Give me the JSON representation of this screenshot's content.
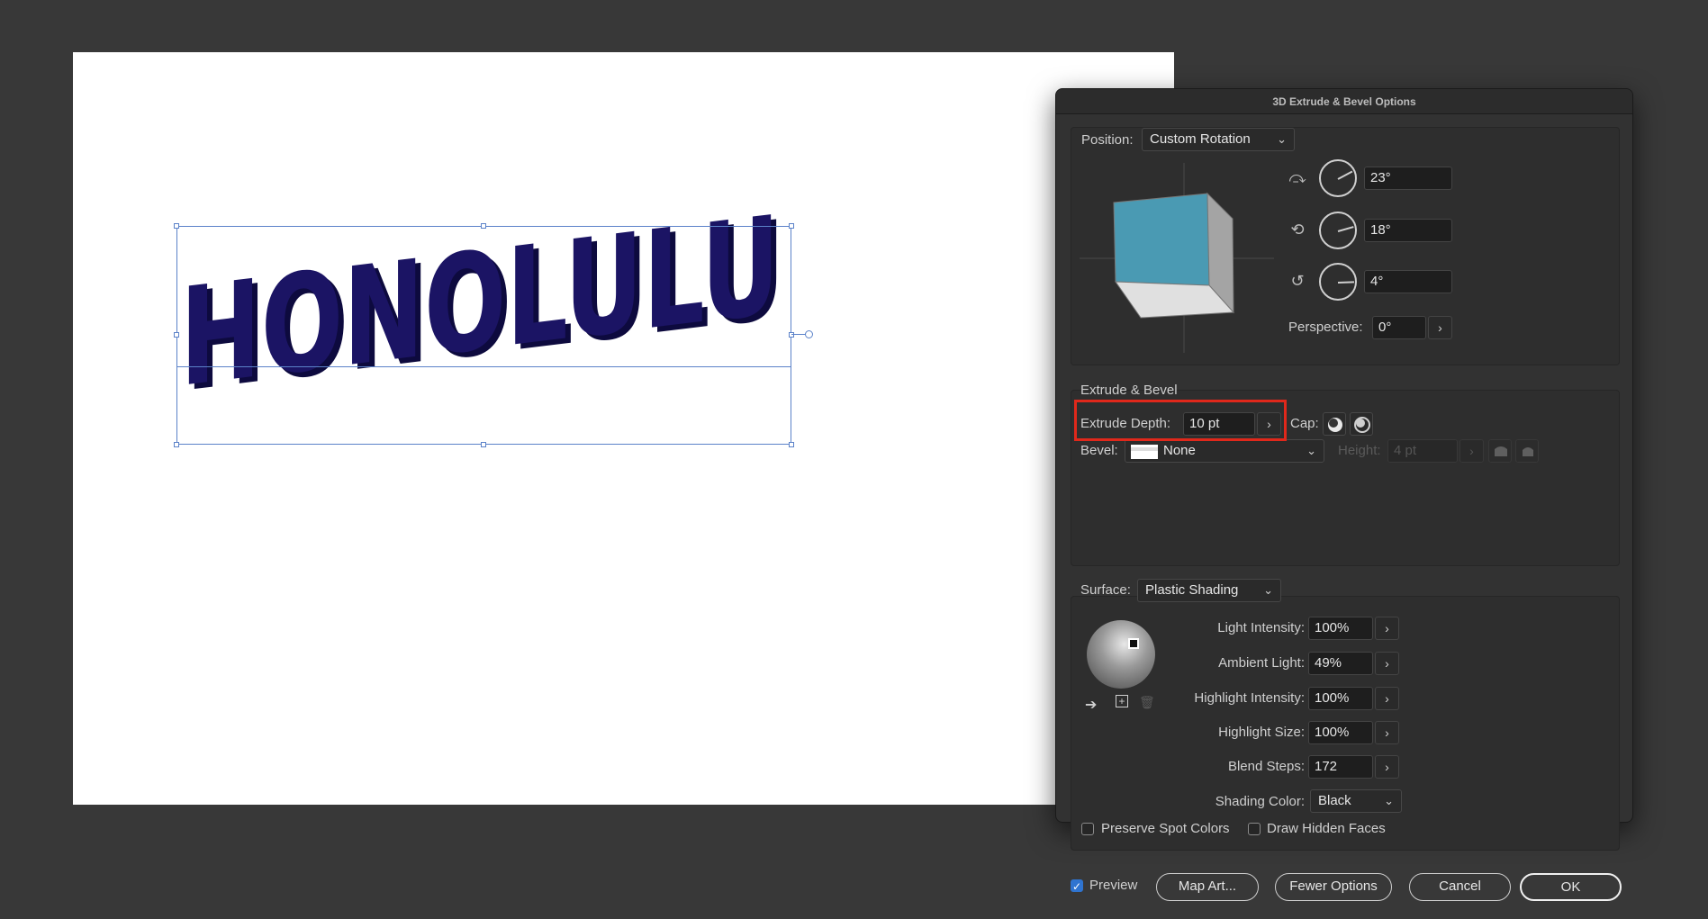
{
  "canvas": {
    "artwork_text": "HONOLULU",
    "artwork_color": "#1b1464",
    "artwork_side_color": "#0d0a3e"
  },
  "dialog": {
    "title": "3D Extrude & Bevel Options",
    "position": {
      "label": "Position:",
      "value": "Custom Rotation",
      "x_rotation": "23°",
      "y_rotation": "18°",
      "z_rotation": "4°",
      "perspective_label": "Perspective:",
      "perspective": "0°"
    },
    "extrude": {
      "section_title": "Extrude & Bevel",
      "depth_label": "Extrude Depth:",
      "depth": "10 pt",
      "cap_label": "Cap:",
      "bevel_label": "Bevel:",
      "bevel": "None",
      "height_label": "Height:",
      "height": "4 pt"
    },
    "surface": {
      "label": "Surface:",
      "value": "Plastic Shading",
      "light_intensity_label": "Light Intensity:",
      "light_intensity": "100%",
      "ambient_light_label": "Ambient Light:",
      "ambient_light": "49%",
      "highlight_intensity_label": "Highlight Intensity:",
      "highlight_intensity": "100%",
      "highlight_size_label": "Highlight Size:",
      "highlight_size": "100%",
      "blend_steps_label": "Blend Steps:",
      "blend_steps": "172",
      "shading_color_label": "Shading Color:",
      "shading_color": "Black"
    },
    "options": {
      "preserve_spot_colors": "Preserve Spot Colors",
      "draw_hidden_faces": "Draw Hidden Faces"
    },
    "footer": {
      "preview": "Preview",
      "map_art": "Map Art...",
      "fewer_options": "Fewer Options",
      "cancel": "Cancel",
      "ok": "OK"
    }
  }
}
